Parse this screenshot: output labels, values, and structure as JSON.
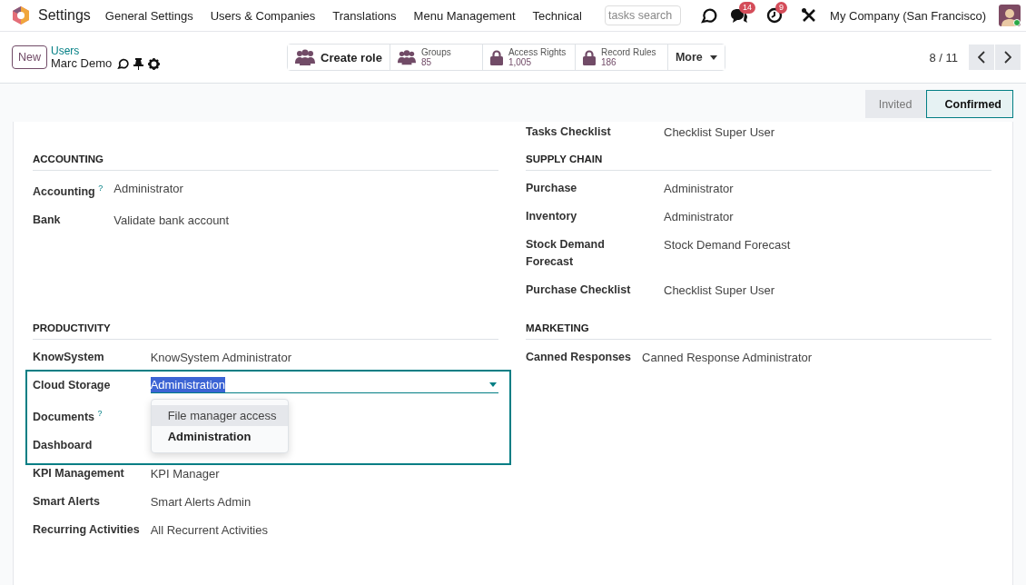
{
  "navbar": {
    "app_name": "Settings",
    "menu": [
      "General Settings",
      "Users & Companies",
      "Translations",
      "Menu Management",
      "Technical"
    ],
    "search_placeholder": "tasks search",
    "messages_count": "14",
    "activities_count": "9",
    "company": "My Company (San Francisco)"
  },
  "control_panel": {
    "new_button": "New",
    "breadcrumb": "Users",
    "record_name": "Marc Demo",
    "buttons": [
      {
        "kind": "action",
        "label": "Create role"
      },
      {
        "kind": "people",
        "label": "Groups",
        "value": "85"
      },
      {
        "kind": "lock",
        "label": "Access Rights",
        "value": "1,005"
      },
      {
        "kind": "lock",
        "label": "Record Rules",
        "value": "186"
      },
      {
        "kind": "dropdown",
        "label": "More"
      }
    ],
    "pager": "8 / 11"
  },
  "status_bar": [
    {
      "label": "Invited",
      "selected": false
    },
    {
      "label": "Confirmed",
      "selected": true
    }
  ],
  "partial_row": {
    "label": "Tasks Checklist",
    "value": "Checklist Super User"
  },
  "groups": [
    {
      "title": "ACCOUNTING",
      "fields": [
        {
          "label": "Accounting",
          "help_mark": "?",
          "value": "Administrator"
        },
        {
          "label": "Bank",
          "value": "Validate bank account"
        }
      ]
    },
    {
      "title": "SUPPLY CHAIN",
      "fields": [
        {
          "label": "Purchase",
          "value": "Administrator"
        },
        {
          "label": "Inventory",
          "value": "Administrator"
        },
        {
          "label": "Stock Demand Forecast",
          "value": "Stock Demand Forecast"
        },
        {
          "label": "Purchase Checklist",
          "value": "Checklist Super User"
        }
      ]
    },
    {
      "title": "PRODUCTIVITY",
      "fields": [
        {
          "label": "KnowSystem",
          "value": "KnowSystem Administrator"
        },
        {
          "label": "Cloud Storage",
          "kind": "open_select",
          "value": "Administration",
          "highlighted": true,
          "options": [
            {
              "label": "File manager access",
              "hovered": true,
              "selected": false
            },
            {
              "label": "Administration",
              "hovered": false,
              "selected": true
            }
          ]
        },
        {
          "label": "Documents",
          "help_mark": "?",
          "highlighted": true
        },
        {
          "label": "Dashboard",
          "highlighted": true
        },
        {
          "label": "KPI Management",
          "value": "KPI Manager"
        },
        {
          "label": "Smart Alerts",
          "value": "Smart Alerts Admin"
        },
        {
          "label": "Recurring Activities",
          "value": "All Recurrent Activities"
        }
      ]
    },
    {
      "title": "MARKETING",
      "fields": [
        {
          "label": "Canned Responses",
          "value": "Canned Response Administrator"
        }
      ]
    }
  ]
}
